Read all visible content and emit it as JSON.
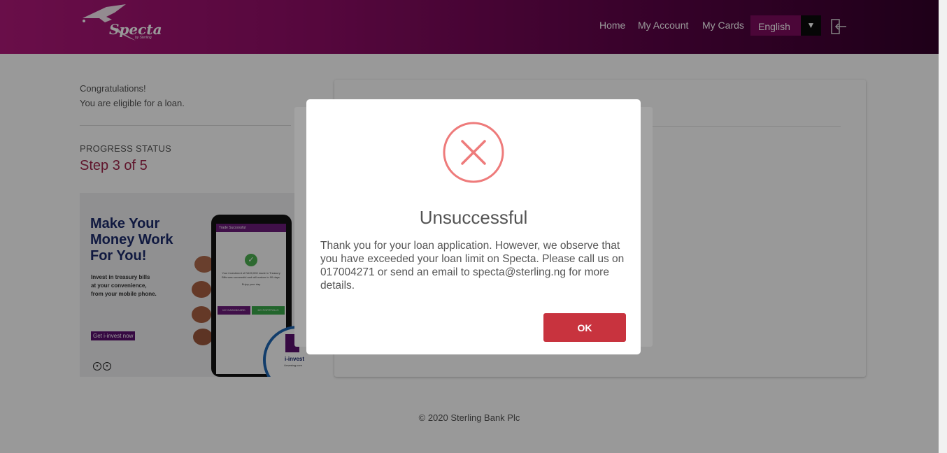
{
  "header": {
    "logo_text": "Specta",
    "logo_sub": "by Sterling",
    "nav": [
      "Home",
      "My Account",
      "My Cards"
    ],
    "language": "English"
  },
  "sidebar": {
    "congrats_line1": "Congratulations!",
    "congrats_line2": "You are eligible for a loan.",
    "progress_label": "PROGRESS STATUS",
    "progress_step": "Step 3 of 5"
  },
  "banner": {
    "headline_1": "Make Your",
    "headline_2": "Money Work",
    "headline_3": "For You!",
    "body_1": "Invest in treasury bills",
    "body_2": "at your convenience,",
    "body_3": "from your mobile phone.",
    "cta": "Get i-invest now",
    "phone_title": "Trade Successful",
    "phone_text": "Your investment of N100,000 made in Treasury Bills was successful and will mature in 90 days.",
    "phone_text2": "Enjoy your day",
    "phone_btn1": "MY DASHBOARD",
    "phone_btn2": "MY PORTFOLIO",
    "iinvest_label": "i-invest",
    "iinvest_sub": "i-investng.com"
  },
  "footer": {
    "copyright": "© 2020 Sterling Bank Plc"
  },
  "modal": {
    "title": "Unsuccessful",
    "message": "Thank you for your loan application. However, we observe that you have exceeded your loan limit on Specta. Please call us on 017004271 or send an email to specta@sterling.ng for more details.",
    "ok_label": "OK"
  },
  "colors": {
    "header_start": "#b0187a",
    "header_end": "#33002a",
    "progress_accent": "#a0264b",
    "error_icon": "#ee7b7b",
    "ok_button": "#c8333e"
  },
  "icons": {
    "error": "x-circle-icon",
    "logout": "logout-icon",
    "dropdown": "triangle-down-icon"
  }
}
